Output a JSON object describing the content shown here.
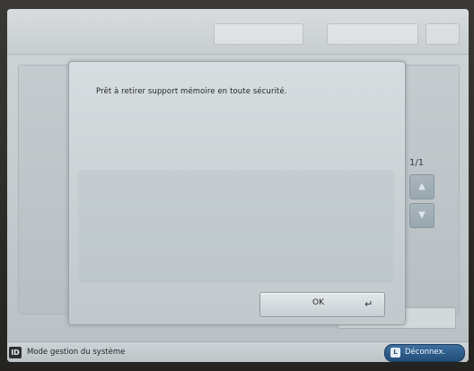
{
  "dialog": {
    "message": "Prêt à retirer support mémoire en toute sécurité.",
    "ok_label": "OK",
    "enter_glyph": "↵"
  },
  "background": {
    "page_indicator": "1/1",
    "scroll_up_glyph": "▲",
    "scroll_down_glyph": "▼"
  },
  "status_bar": {
    "id_badge": "ID",
    "mode_label": "Mode gestion du système",
    "logout_icon": "L",
    "logout_label": "Déconnex."
  },
  "colors": {
    "logout_button": "#234d78",
    "screen_background": "#c4cacd"
  }
}
